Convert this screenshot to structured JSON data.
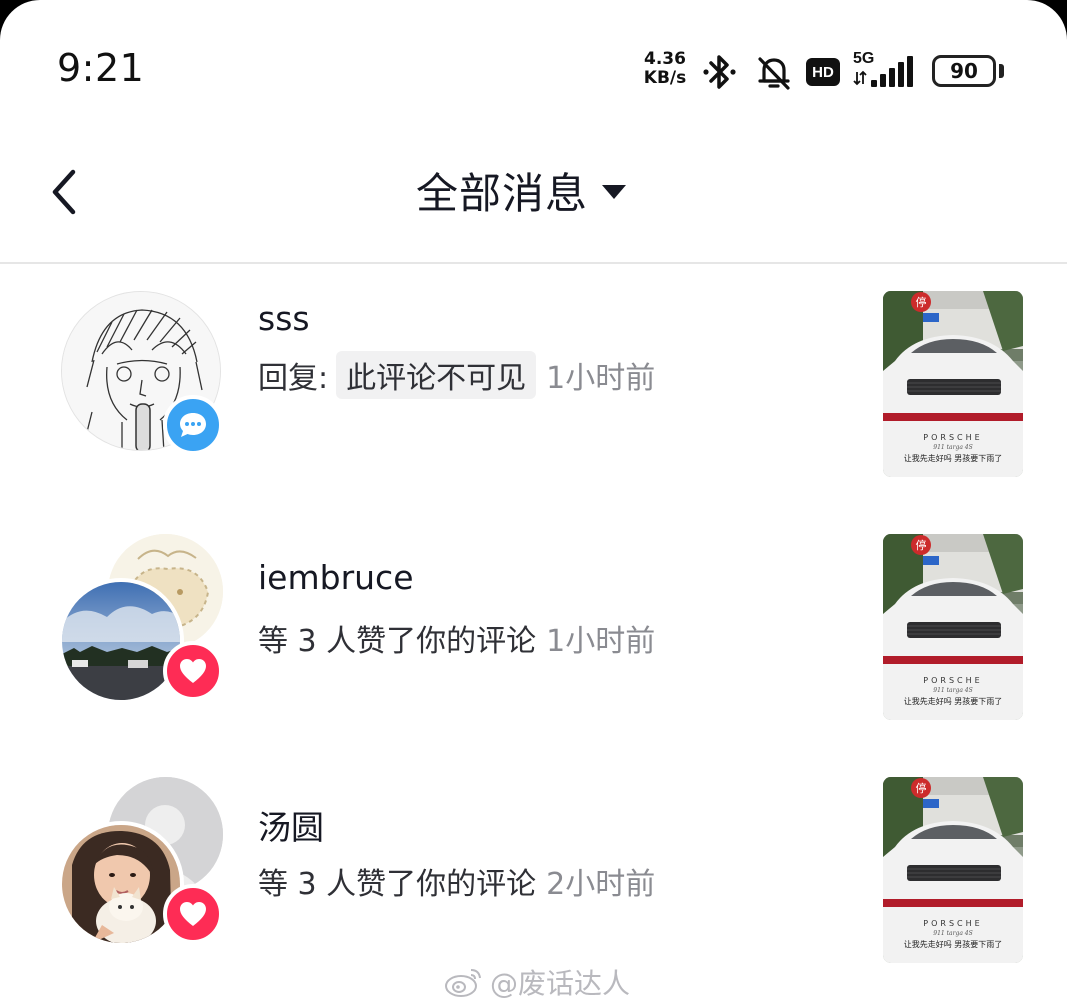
{
  "status_bar": {
    "time": "9:21",
    "net_speed_value": "4.36",
    "net_speed_unit": "KB/s",
    "network": "5G",
    "hd_label": "HD",
    "battery": "90",
    "icons": [
      "bluetooth-icon",
      "bell-muted-icon",
      "hd-icon",
      "signal-5g-icon",
      "battery-icon"
    ]
  },
  "header": {
    "back_icon": "chevron-left-icon",
    "title": "全部消息",
    "dropdown_icon": "caret-down-icon"
  },
  "messages": [
    {
      "username": "sss",
      "prefix": "回复:",
      "content": "此评论不可见",
      "time": "1小时前",
      "badge": "comment-icon",
      "badge_color": "#3aa3f3"
    },
    {
      "username": "iembruce",
      "text": "等 3 人赞了你的评论",
      "time": "1小时前",
      "badge": "heart-icon",
      "badge_color": "#fe2c55"
    },
    {
      "username": "汤圆",
      "text": "等 3 人赞了你的评论",
      "time": "2小时前",
      "badge": "heart-icon",
      "badge_color": "#fe2c55"
    }
  ],
  "thumbnail": {
    "brand_text": "PORSCHE",
    "model_text": "911 targa 4S",
    "caption_text": "让我先走好吗 男孩要下雨了",
    "sign_text": "停"
  },
  "watermark": {
    "icon": "weibo-icon",
    "text": "@废话达人"
  },
  "colors": {
    "text_primary": "#161823",
    "text_secondary": "#8a8b91",
    "like_badge": "#fe2c55",
    "comment_badge": "#3aa3f3"
  }
}
